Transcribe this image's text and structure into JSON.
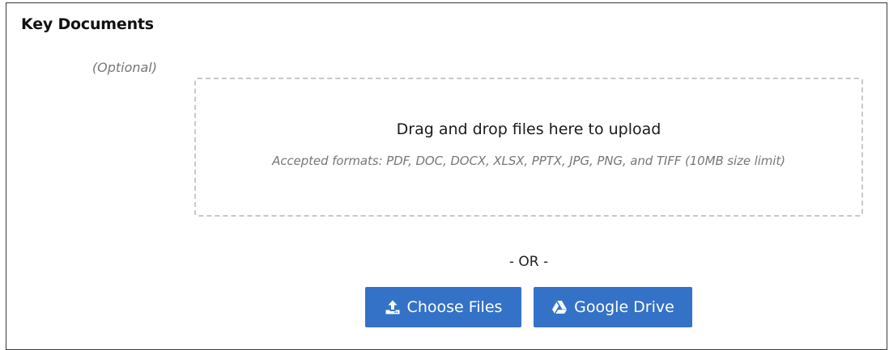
{
  "section": {
    "title": "Key Documents",
    "optional_label": "(Optional)"
  },
  "dropzone": {
    "title": "Drag and drop files here to upload",
    "formats": "Accepted formats: PDF, DOC, DOCX, XLSX, PPTX, JPG, PNG, and TIFF (10MB size limit)"
  },
  "divider": {
    "label": "- OR -"
  },
  "buttons": {
    "choose_files": {
      "label": "Choose Files",
      "icon": "upload-icon"
    },
    "google_drive": {
      "label": "Google Drive",
      "icon": "google-drive-icon"
    }
  },
  "colors": {
    "button_bg": "#3472c7",
    "button_text": "#ffffff",
    "dropzone_border": "#c8c8c8",
    "muted_text": "#777777"
  }
}
